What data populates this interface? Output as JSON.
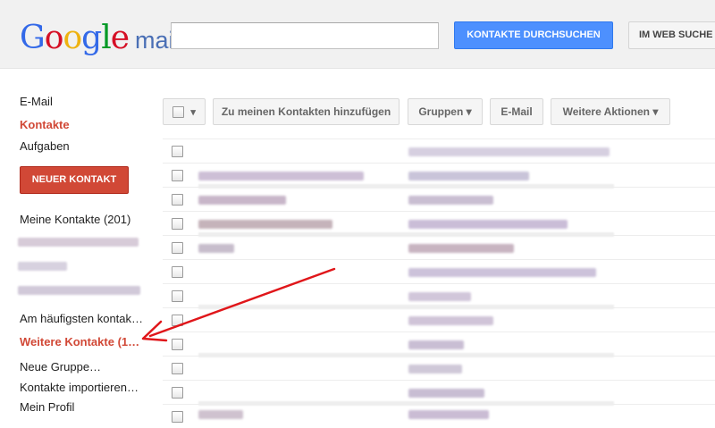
{
  "header": {
    "logo_letters": [
      {
        "ch": "G",
        "color": "#3369e8"
      },
      {
        "ch": "o",
        "color": "#d50f25"
      },
      {
        "ch": "o",
        "color": "#eeb211"
      },
      {
        "ch": "g",
        "color": "#3369e8"
      },
      {
        "ch": "l",
        "color": "#009925"
      },
      {
        "ch": "e",
        "color": "#d50f25"
      }
    ],
    "logo_suffix": "mail",
    "search_value": "",
    "search_contacts_button": "KONTAKTE DURCHSUCHEN",
    "web_search_button": "IM WEB SUCHE"
  },
  "sidebar": {
    "nav": [
      {
        "label": "E-Mail",
        "active": false
      },
      {
        "label": "Kontakte",
        "active": true
      },
      {
        "label": "Aufgaben",
        "active": false
      }
    ],
    "new_contact_button": "NEUER KONTAKT",
    "groups": [
      {
        "label": "Meine Kontakte (201)",
        "active": false
      },
      {
        "label": "Am häufigsten kontak…",
        "active": false
      },
      {
        "label": "Weitere Kontakte (1…",
        "active": true
      },
      {
        "label": "Neue Gruppe…",
        "active": false
      },
      {
        "label": "Kontakte importieren…",
        "active": false
      },
      {
        "label": "Mein Profil",
        "active": false
      }
    ]
  },
  "toolbar": {
    "select_dropdown": "▾",
    "add_to_contacts": "Zu meinen Kontakten hinzufügen",
    "groups": "Gruppen ▾",
    "email": "E-Mail",
    "more_actions": "Weitere Aktionen ▾"
  },
  "colors": {
    "accent_blue": "#4d90fe",
    "accent_red": "#d14836",
    "arrow_red": "#e0161a"
  },
  "icons": [
    "checkbox-icon",
    "chevron-down-icon",
    "arrow-annotation-icon"
  ]
}
